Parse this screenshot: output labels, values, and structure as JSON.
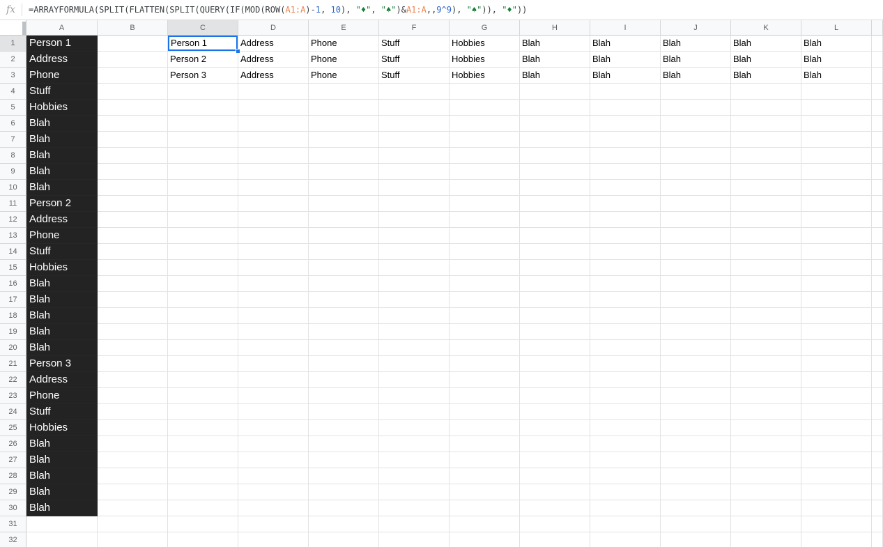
{
  "formula_bar": {
    "fx_label": "fx",
    "segments": [
      {
        "text": "=ARRAYFORMULA(SPLIT(FLATTEN(SPLIT(QUERY(IF(MOD(ROW(",
        "type": "default"
      },
      {
        "text": "A1:A",
        "type": "range"
      },
      {
        "text": ")-",
        "type": "default"
      },
      {
        "text": "1",
        "type": "number"
      },
      {
        "text": ", ",
        "type": "default"
      },
      {
        "text": "10",
        "type": "number"
      },
      {
        "text": "), ",
        "type": "default"
      },
      {
        "text": "\"♦\"",
        "type": "string"
      },
      {
        "text": ", ",
        "type": "default"
      },
      {
        "text": "\"♠\"",
        "type": "string"
      },
      {
        "text": ")&",
        "type": "default"
      },
      {
        "text": "A1:A",
        "type": "range"
      },
      {
        "text": ",,",
        "type": "default"
      },
      {
        "text": "9^9",
        "type": "number"
      },
      {
        "text": "), ",
        "type": "default"
      },
      {
        "text": "\"♠\"",
        "type": "string"
      },
      {
        "text": ")), ",
        "type": "default"
      },
      {
        "text": "\"♦\"",
        "type": "string"
      },
      {
        "text": "))",
        "type": "default"
      }
    ]
  },
  "colors": {
    "selection_blue": "#1a73e8",
    "dark_cell_bg": "#232323",
    "dark_cell_text": "#ffffff",
    "header_bg": "#f8f9fa",
    "header_highlight_bg": "#e2e3e4",
    "header_text": "#5f6368",
    "gridline": "#e2e2e4",
    "formula_default": "#3c4043",
    "formula_range_ref": "#e8824d",
    "formula_number": "#2e64c9",
    "formula_string": "#188038"
  },
  "grid": {
    "column_headers": [
      "A",
      "B",
      "C",
      "D",
      "E",
      "F",
      "G",
      "H",
      "I",
      "J",
      "K",
      "L"
    ],
    "row_count": 32,
    "selected_cell": "C1",
    "selected_column": "C",
    "selected_row": 1,
    "column_a_values": [
      "Person 1",
      "Address",
      "Phone",
      "Stuff",
      "Hobbies",
      "Blah",
      "Blah",
      "Blah",
      "Blah",
      "Blah",
      "Person 2",
      "Address",
      "Phone",
      "Stuff",
      "Hobbies",
      "Blah",
      "Blah",
      "Blah",
      "Blah",
      "Blah",
      "Person 3",
      "Address",
      "Phone",
      "Stuff",
      "Hobbies",
      "Blah",
      "Blah",
      "Blah",
      "Blah",
      "Blah"
    ],
    "result_rows": [
      [
        "Person 1",
        "Address",
        "Phone",
        "Stuff",
        "Hobbies",
        "Blah",
        "Blah",
        "Blah",
        "Blah",
        "Blah"
      ],
      [
        "Person 2",
        "Address",
        "Phone",
        "Stuff",
        "Hobbies",
        "Blah",
        "Blah",
        "Blah",
        "Blah",
        "Blah"
      ],
      [
        "Person 3",
        "Address",
        "Phone",
        "Stuff",
        "Hobbies",
        "Blah",
        "Blah",
        "Blah",
        "Blah",
        "Blah"
      ]
    ]
  }
}
